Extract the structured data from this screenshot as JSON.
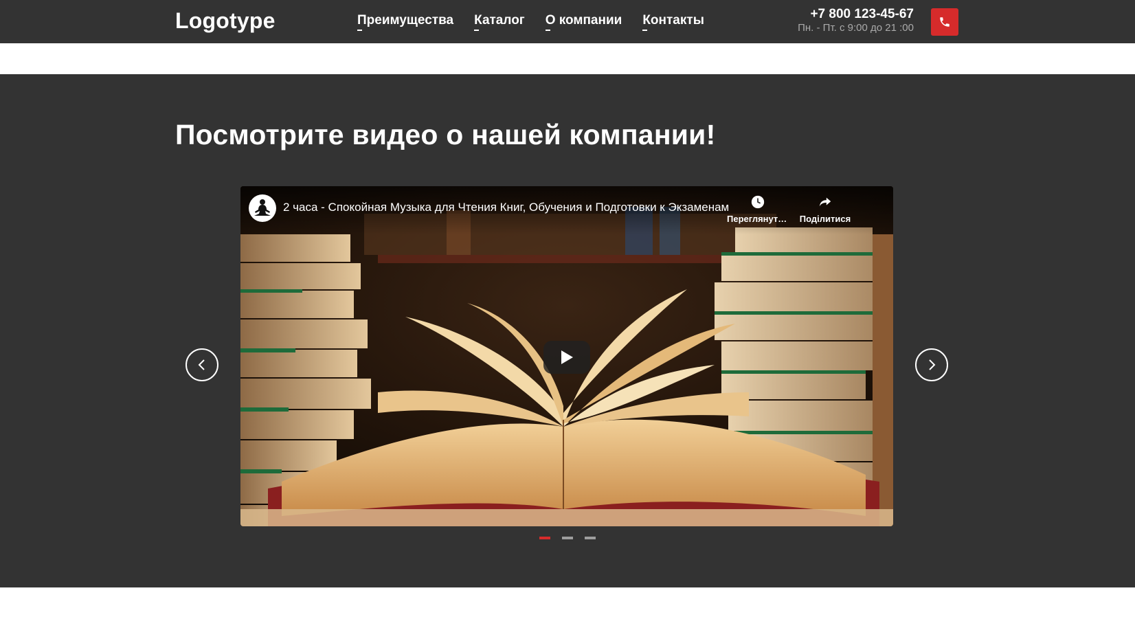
{
  "header": {
    "logo": "Logotype",
    "nav": [
      {
        "label": "Преимущества"
      },
      {
        "label": "Каталог"
      },
      {
        "label": "О компании"
      },
      {
        "label": "Контакты"
      }
    ],
    "phone": "+7 800 123-45-67",
    "hours": "Пн. - Пт. с 9:00 до 21 :00",
    "call_icon": "phone-icon"
  },
  "section": {
    "title": "Посмотрите видео о нашей компании!"
  },
  "video": {
    "title": "2 часа - Спокойная Музыка для Чтения Книг, Обучения и Подготовки к Экзаменам",
    "watch_later_label": "Переглянути пізніше",
    "share_label": "Поділитися",
    "channel_icon": "meditation-avatar-icon",
    "play_icon": "play-icon"
  },
  "carousel": {
    "slides_count": 3,
    "active_slide": 1,
    "prev_icon": "chevron-left-icon",
    "next_icon": "chevron-right-icon"
  },
  "colors": {
    "background_dark": "#333333",
    "accent": "#d62b2b",
    "text_light": "#ffffff",
    "text_muted": "#aaaaaa"
  }
}
